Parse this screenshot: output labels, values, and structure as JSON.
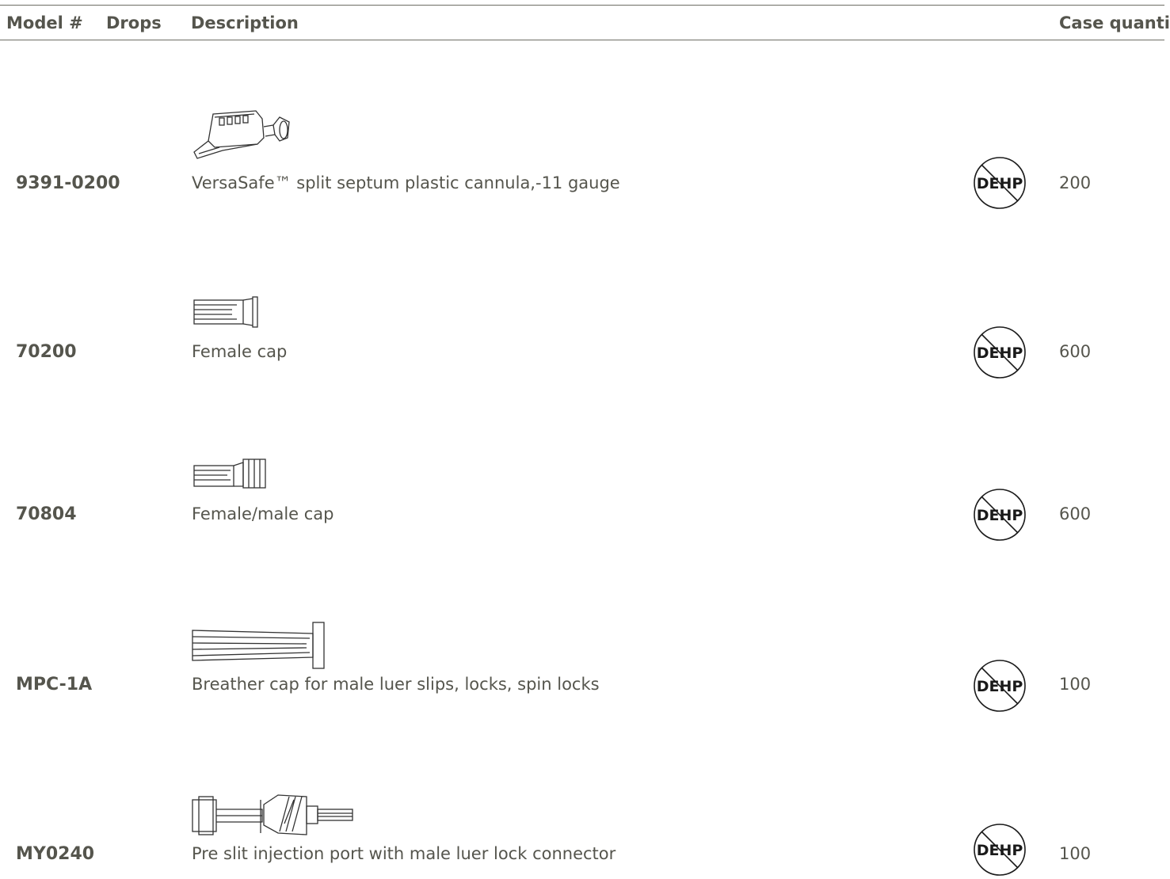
{
  "table": {
    "headers": {
      "model": "Model #",
      "drops": "Drops",
      "description": "Description",
      "case_quantity": "Case quantity"
    },
    "rows": [
      {
        "model": "9391-0200",
        "description": "VersaSafe™ split septum plastic cannula,-11 gauge",
        "badge": "DEHP",
        "quantity": "200",
        "illustration": "cannula-illustration"
      },
      {
        "model": "70200",
        "description": "Female cap",
        "badge": "DEHP",
        "quantity": "600",
        "illustration": "female-cap-illustration"
      },
      {
        "model": "70804",
        "description": "Female/male cap",
        "badge": "DEHP",
        "quantity": "600",
        "illustration": "female-male-cap-illustration"
      },
      {
        "model": "MPC-1A",
        "description": "Breather cap for male luer slips, locks, spin locks",
        "badge": "DEHP",
        "quantity": "100",
        "illustration": "breather-cap-illustration"
      },
      {
        "model": "MY0240",
        "description": "Pre slit injection port with male luer lock connector",
        "badge": "DEHP",
        "quantity": "100",
        "illustration": "injection-port-illustration"
      }
    ]
  }
}
